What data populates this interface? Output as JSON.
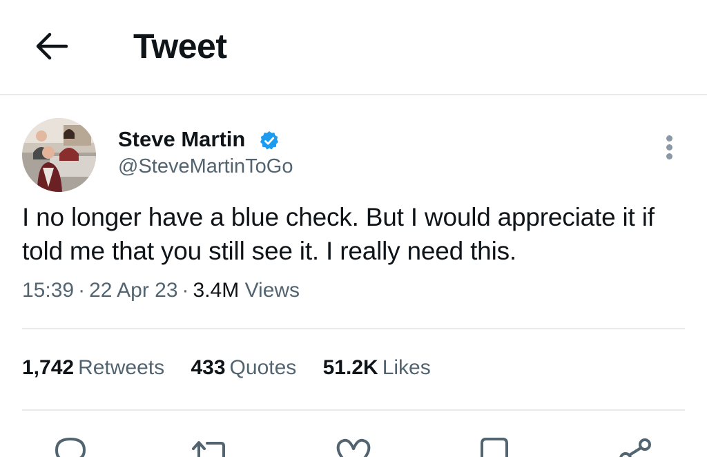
{
  "header": {
    "title": "Tweet",
    "back_icon": "arrow-left-icon"
  },
  "author": {
    "name": "Steve Martin",
    "handle": "@SteveMartinToGo",
    "verified": true,
    "verified_color": "#1d9bf0"
  },
  "tweet": {
    "text": "I no longer have a blue check. But I would appreciate it if told me that you still see it. I really need this.",
    "time": "15:39",
    "date": "22 Apr 23",
    "views_count": "3.4M",
    "views_label": "Views"
  },
  "stats": {
    "retweets_count": "1,742",
    "retweets_label": "Retweets",
    "quotes_count": "433",
    "quotes_label": "Quotes",
    "likes_count": "51.2K",
    "likes_label": "Likes"
  },
  "actions": [
    "reply-icon",
    "retweet-icon",
    "like-icon",
    "bookmark-icon",
    "share-icon"
  ],
  "colors": {
    "text_primary": "#0f1419",
    "text_secondary": "#536471",
    "divider": "#e7e9ea"
  }
}
